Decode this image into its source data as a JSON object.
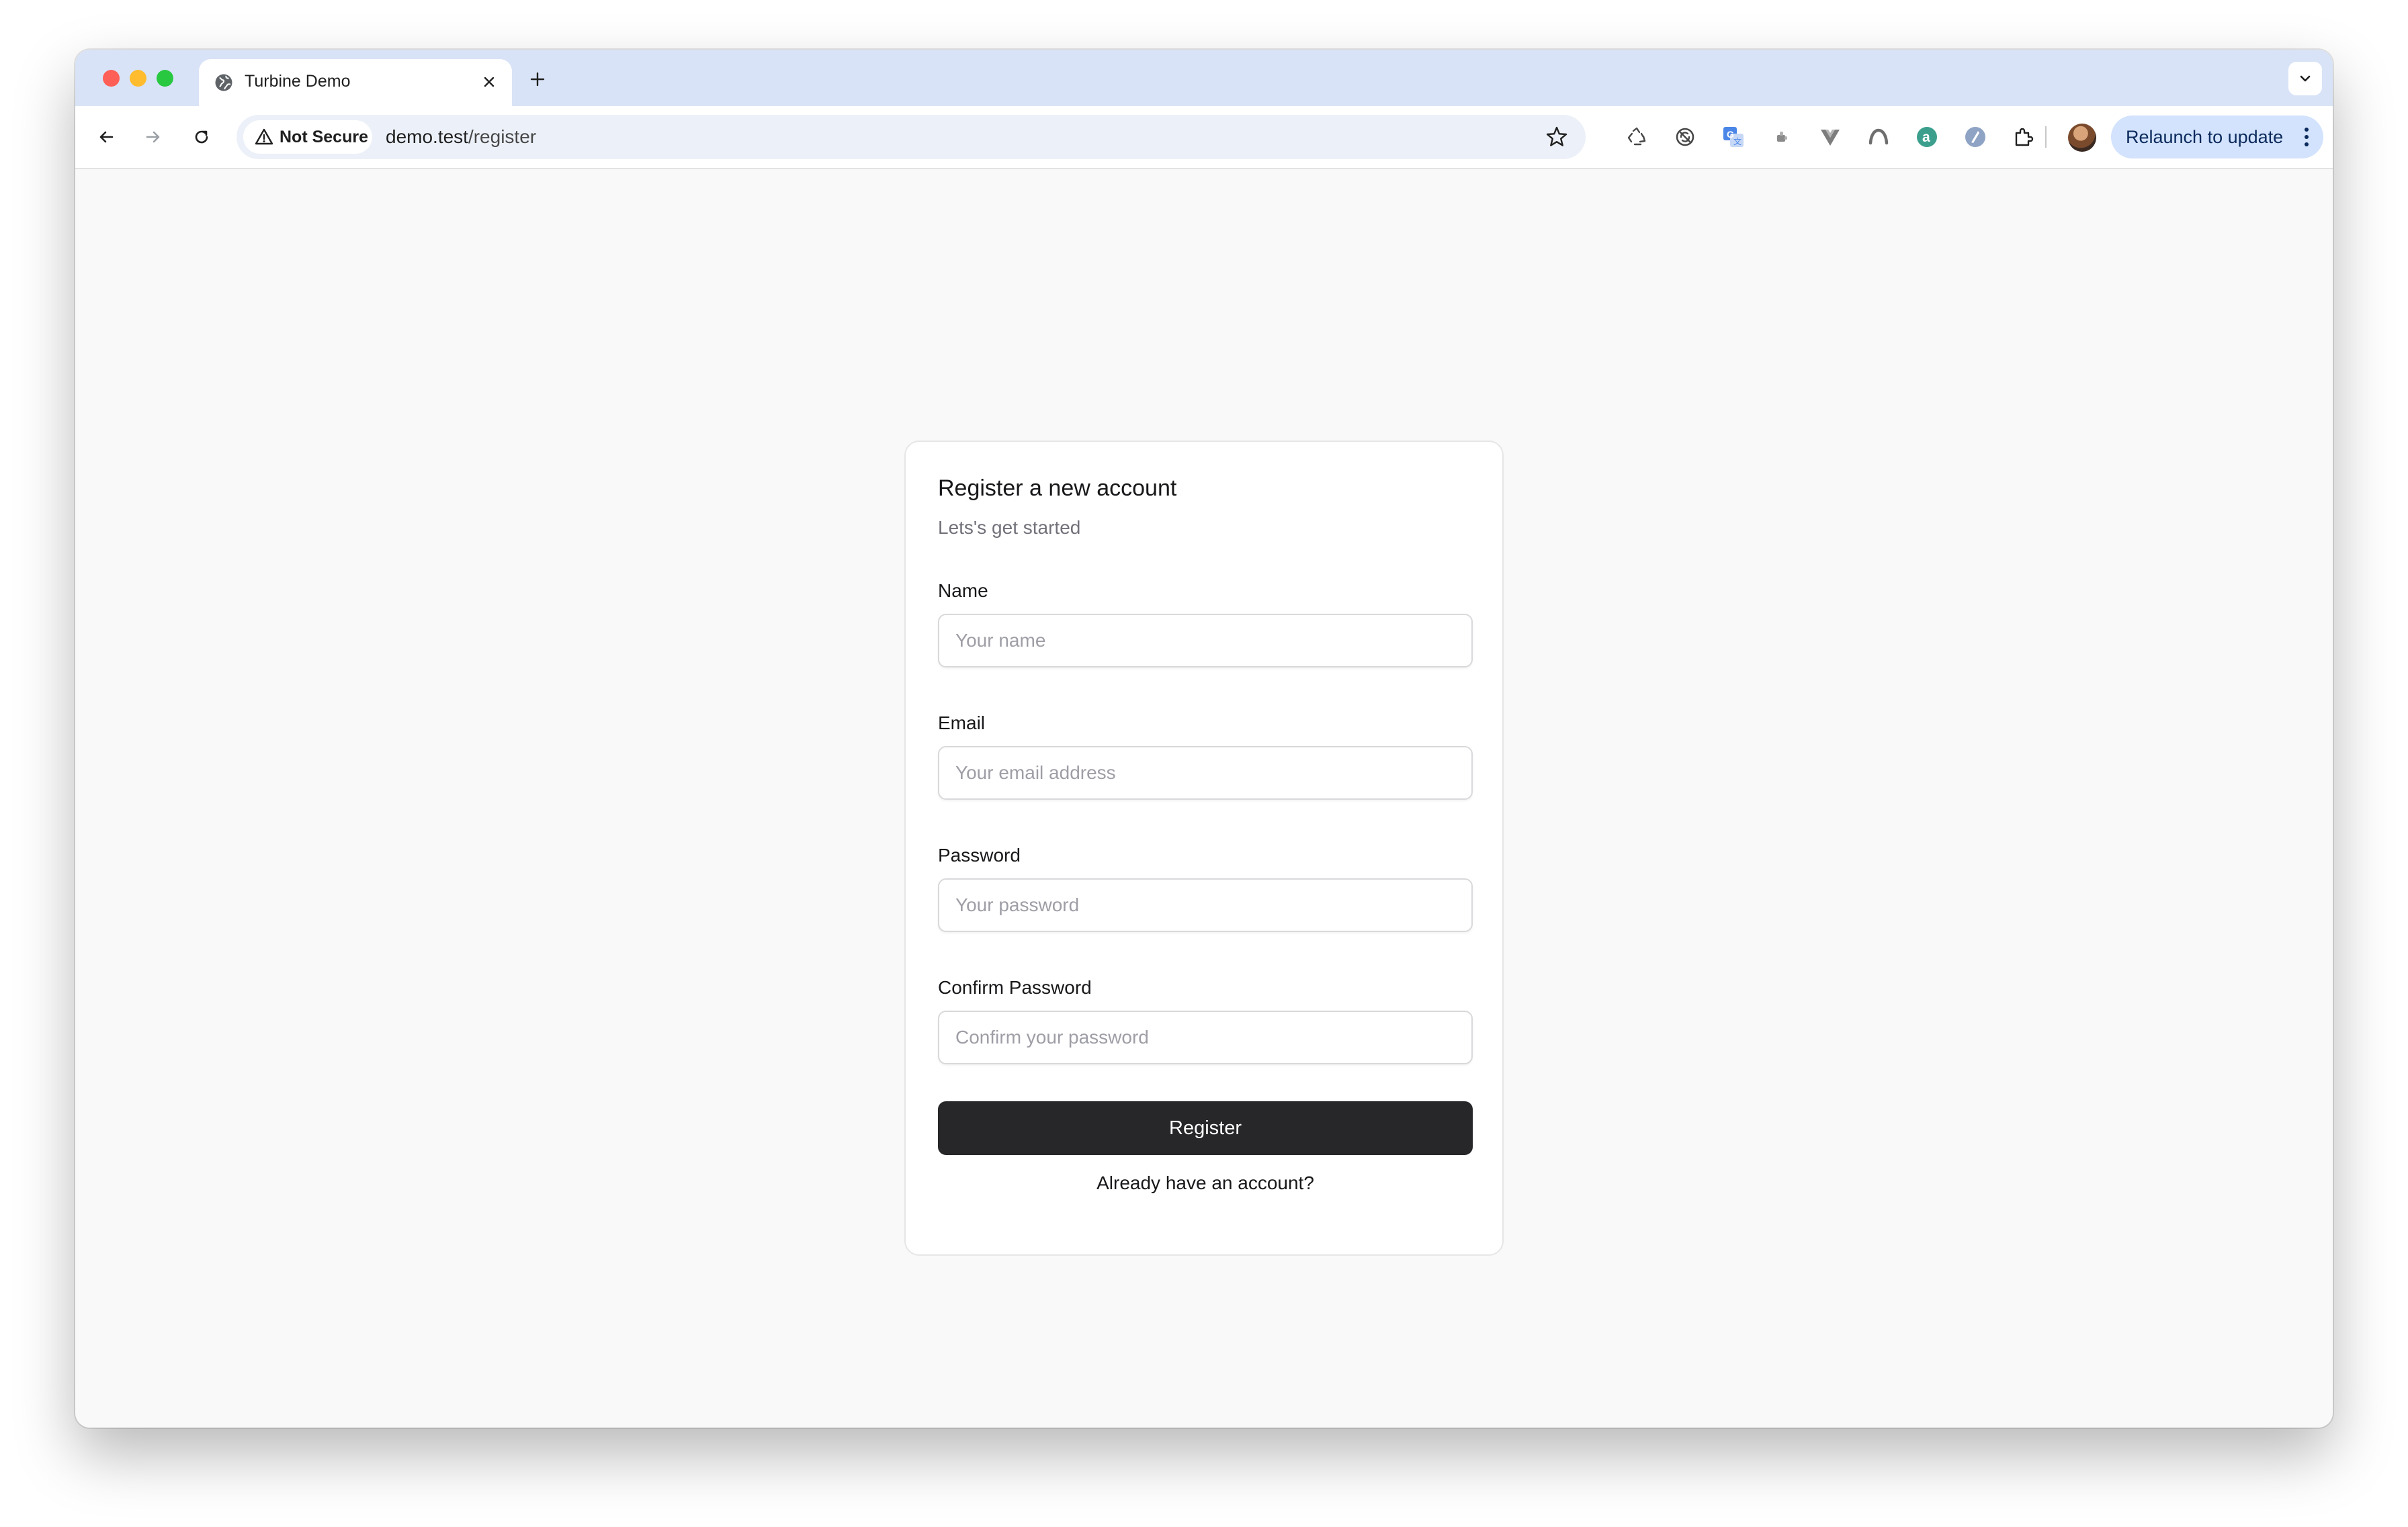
{
  "browser": {
    "tab": {
      "title": "Turbine Demo",
      "favicon": "globe-icon"
    },
    "address": {
      "security_label": "Not Secure",
      "domain": "demo.test",
      "path": "/register"
    },
    "relaunch_label": "Relaunch to update",
    "extensions": [
      "recycle-icon",
      "refresh-circle-icon",
      "translate-icon",
      "puzzle-small-icon",
      "vue-icon",
      "arc-icon",
      "a-circle-icon",
      "shield-circle-icon",
      "extensions-puzzle-icon"
    ]
  },
  "form": {
    "title": "Register a new account",
    "subtitle": "Lets's get started",
    "fields": [
      {
        "label": "Name",
        "placeholder": "Your name",
        "value": ""
      },
      {
        "label": "Email",
        "placeholder": "Your email address",
        "value": ""
      },
      {
        "label": "Password",
        "placeholder": "Your password",
        "value": ""
      },
      {
        "label": "Confirm Password",
        "placeholder": "Confirm your password",
        "value": ""
      }
    ],
    "submit_label": "Register",
    "login_link": "Already have an account?"
  },
  "colors": {
    "tabstrip": "#d9e3f7",
    "page_bg": "#f9f9f9",
    "button_bg": "#27272a",
    "relaunch_bg": "#d3e3fd"
  }
}
